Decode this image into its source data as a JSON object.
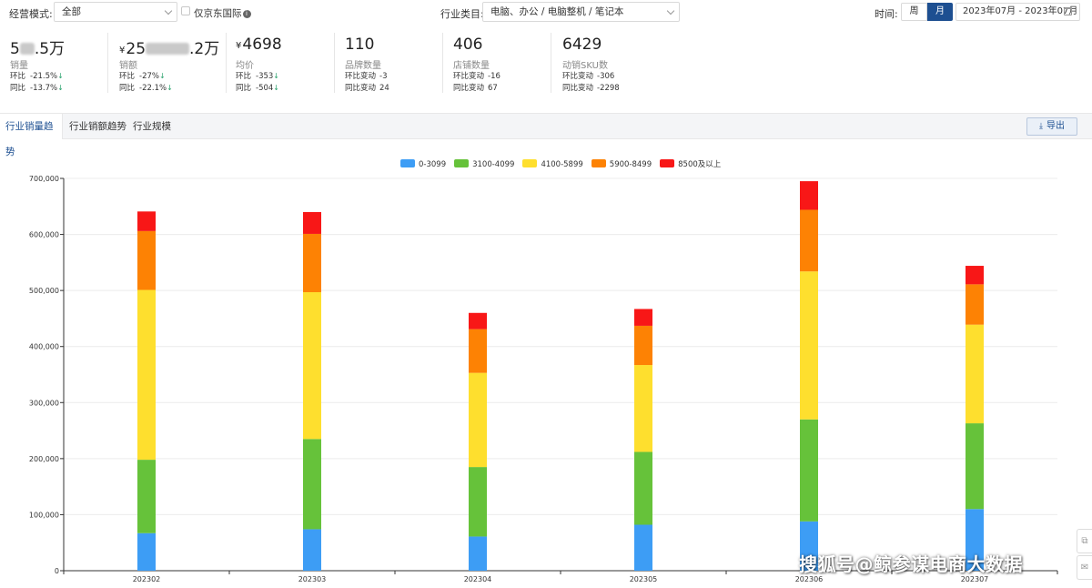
{
  "filters": {
    "mode_label": "经营模式:",
    "mode_value": "全部",
    "jd_intl_label": "仅京东国际",
    "category_label": "行业类目:",
    "category_value": "电脑、办公 / 电脑整机 / 笔记本",
    "time_label": "时间:",
    "week_label": "周",
    "month_label": "月",
    "date_range": "2023年07月 - 2023年07月"
  },
  "kpis": [
    {
      "value_prefix": "5",
      "value_suffix": ".5万",
      "name": "销量",
      "l1_label": "环比",
      "l1_value": "-21.5%",
      "l2_label": "同比",
      "l2_value": "-13.7%"
    },
    {
      "currency": "¥",
      "value_prefix": "25",
      "value_suffix": ".2万",
      "name": "销额",
      "l1_label": "环比",
      "l1_value": "-27%",
      "l2_label": "同比",
      "l2_value": "-22.1%"
    },
    {
      "currency": "¥",
      "value": "4698",
      "name": "均价",
      "l1_label": "环比",
      "l1_value": "-353",
      "l2_label": "同比",
      "l2_value": "-504"
    },
    {
      "value": "110",
      "name": "品牌数量",
      "l1_label": "环比变动",
      "l1_value": "-3",
      "l2_label": "同比变动",
      "l2_value": "24"
    },
    {
      "value": "406",
      "name": "店铺数量",
      "l1_label": "环比变动",
      "l1_value": "-16",
      "l2_label": "同比变动",
      "l2_value": "67"
    },
    {
      "value": "6429",
      "name": "动销SKU数",
      "l1_label": "环比变动",
      "l1_value": "-306",
      "l2_label": "同比变动",
      "l2_value": "-2298"
    }
  ],
  "tabs": [
    "行业销量趋势",
    "行业销额趋势",
    "行业规模"
  ],
  "export_label": "导出",
  "watermark": "搜狐号@鲸参谋电商大数据",
  "colors": {
    "primary": "#1d4f91",
    "down_arrow": "#2ca46f"
  },
  "chart_data": {
    "type": "bar",
    "stacked": true,
    "categories": [
      "202302",
      "202303",
      "202304",
      "202305",
      "202306",
      "202307"
    ],
    "series": [
      {
        "name": "0-3099",
        "color": "#3d9df5",
        "values": [
          67000,
          74000,
          61000,
          82000,
          88000,
          110000
        ]
      },
      {
        "name": "3100-4099",
        "color": "#66c23a",
        "values": [
          131000,
          161000,
          124000,
          130000,
          182000,
          153000
        ]
      },
      {
        "name": "4100-5899",
        "color": "#fedf2e",
        "values": [
          303000,
          262000,
          168000,
          155000,
          264000,
          176000
        ]
      },
      {
        "name": "5900-8499",
        "color": "#fd8204",
        "values": [
          105000,
          104000,
          78000,
          70000,
          110000,
          72000
        ]
      },
      {
        "name": "8500及以上",
        "color": "#f81717",
        "values": [
          35000,
          39000,
          29000,
          30000,
          51000,
          33000
        ]
      }
    ],
    "ylim": [
      0,
      700000
    ],
    "yticks": [
      "0",
      "100,000",
      "200,000",
      "300,000",
      "400,000",
      "500,000",
      "600,000",
      "700,000"
    ],
    "legend_position": "top-center",
    "grid": true
  }
}
